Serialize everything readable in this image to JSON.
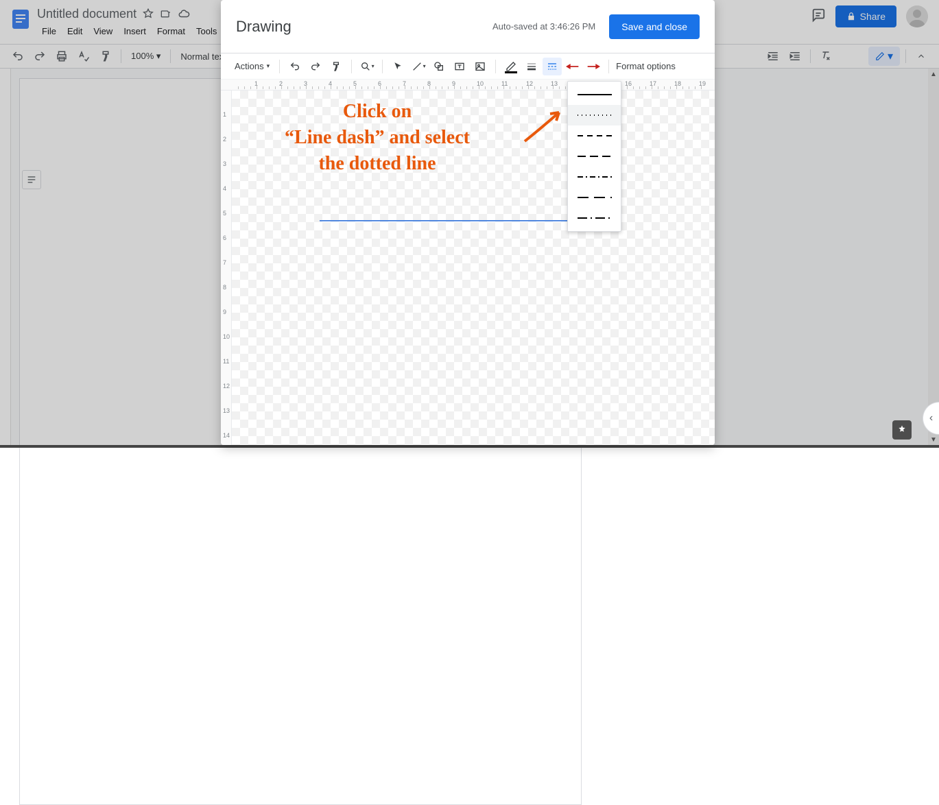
{
  "docs": {
    "title": "Untitled document",
    "menus": [
      "File",
      "Edit",
      "View",
      "Insert",
      "Format",
      "Tools"
    ],
    "share_label": "Share",
    "toolbar": {
      "zoom": "100%",
      "style": "Normal text"
    }
  },
  "modal": {
    "title": "Drawing",
    "autosave": "Auto-saved at 3:46:26 PM",
    "save_label": "Save and close",
    "actions_label": "Actions",
    "format_options_label": "Format options",
    "line_dash_options": [
      {
        "id": "solid",
        "hover": false
      },
      {
        "id": "dotted",
        "hover": true
      },
      {
        "id": "dash",
        "hover": false
      },
      {
        "id": "long-dash",
        "hover": false
      },
      {
        "id": "dash-dot",
        "hover": false
      },
      {
        "id": "long-dash-long",
        "hover": false
      },
      {
        "id": "long-dash-dot",
        "hover": false
      }
    ]
  },
  "annotation": {
    "line1": "Click on",
    "line2": "“Line dash” and select",
    "line3": "the dotted line"
  }
}
